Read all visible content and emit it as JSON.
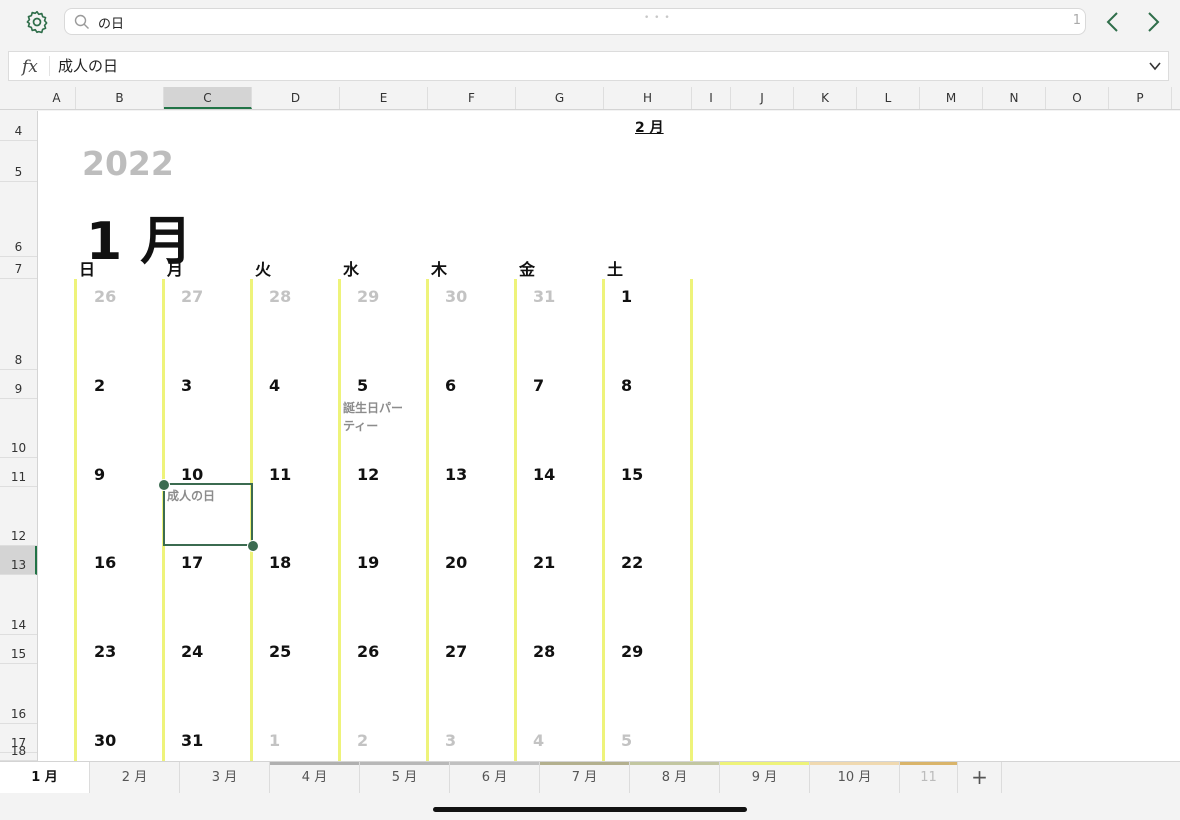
{
  "search": {
    "query": "の日",
    "count": "1"
  },
  "formula": {
    "fx_label": "fx",
    "value": "成人の日"
  },
  "columns": [
    "A",
    "B",
    "C",
    "D",
    "E",
    "F",
    "G",
    "H",
    "I",
    "J",
    "K",
    "L",
    "M",
    "N",
    "O",
    "P"
  ],
  "selected_column": "C",
  "rows": [
    "4",
    "5",
    "6",
    "7",
    "8",
    "9",
    "10",
    "11",
    "12",
    "13",
    "14",
    "15",
    "16",
    "17",
    "18"
  ],
  "selected_row": "13",
  "calendar": {
    "month_link": "2 月",
    "year": "2022",
    "month": "1 月",
    "weekdays": [
      "日",
      "月",
      "火",
      "水",
      "木",
      "金",
      "土"
    ],
    "weeks": [
      [
        {
          "d": "26",
          "grey": true
        },
        {
          "d": "27",
          "grey": true
        },
        {
          "d": "28",
          "grey": true
        },
        {
          "d": "29",
          "grey": true
        },
        {
          "d": "30",
          "grey": true
        },
        {
          "d": "31",
          "grey": true
        },
        {
          "d": "1",
          "grey": false
        }
      ],
      [
        {
          "d": "2",
          "grey": false
        },
        {
          "d": "3",
          "grey": false
        },
        {
          "d": "4",
          "grey": false
        },
        {
          "d": "5",
          "grey": false
        },
        {
          "d": "6",
          "grey": false
        },
        {
          "d": "7",
          "grey": false
        },
        {
          "d": "8",
          "grey": false
        }
      ],
      [
        {
          "d": "9",
          "grey": false
        },
        {
          "d": "10",
          "grey": false
        },
        {
          "d": "11",
          "grey": false
        },
        {
          "d": "12",
          "grey": false
        },
        {
          "d": "13",
          "grey": false
        },
        {
          "d": "14",
          "grey": false
        },
        {
          "d": "15",
          "grey": false
        }
      ],
      [
        {
          "d": "16",
          "grey": false
        },
        {
          "d": "17",
          "grey": false
        },
        {
          "d": "18",
          "grey": false
        },
        {
          "d": "19",
          "grey": false
        },
        {
          "d": "20",
          "grey": false
        },
        {
          "d": "21",
          "grey": false
        },
        {
          "d": "22",
          "grey": false
        }
      ],
      [
        {
          "d": "23",
          "grey": false
        },
        {
          "d": "24",
          "grey": false
        },
        {
          "d": "25",
          "grey": false
        },
        {
          "d": "26",
          "grey": false
        },
        {
          "d": "27",
          "grey": false
        },
        {
          "d": "28",
          "grey": false
        },
        {
          "d": "29",
          "grey": false
        }
      ],
      [
        {
          "d": "30",
          "grey": false
        },
        {
          "d": "31",
          "grey": false
        },
        {
          "d": "1",
          "grey": true
        },
        {
          "d": "2",
          "grey": true
        },
        {
          "d": "3",
          "grey": true
        },
        {
          "d": "4",
          "grey": true
        },
        {
          "d": "5",
          "grey": true
        }
      ]
    ],
    "events": {
      "birthday_line1": "誕生日パー",
      "birthday_line2": "ティー",
      "holiday": "成人の日"
    }
  },
  "sheets": [
    {
      "label": "1 月",
      "active": true,
      "color": ""
    },
    {
      "label": "2 月",
      "active": false,
      "color": ""
    },
    {
      "label": "3 月",
      "active": false,
      "color": ""
    },
    {
      "label": "4 月",
      "active": false,
      "color": "#b0b0b0"
    },
    {
      "label": "5 月",
      "active": false,
      "color": "#b8b8b8"
    },
    {
      "label": "6 月",
      "active": false,
      "color": "#c0c0c0"
    },
    {
      "label": "7 月",
      "active": false,
      "color": "#b3b08e"
    },
    {
      "label": "8 月",
      "active": false,
      "color": "#c2c6a0"
    },
    {
      "label": "9 月",
      "active": false,
      "color": "#eef37a"
    },
    {
      "label": "10 月",
      "active": false,
      "color": "#f0d9b0"
    },
    {
      "label": "11",
      "active": false,
      "color": "#d9b46a"
    }
  ],
  "add_sheet_label": "+",
  "colors": {
    "accent": "#217346",
    "selection": "#3b6b50",
    "column_rule": "#eef37a"
  }
}
